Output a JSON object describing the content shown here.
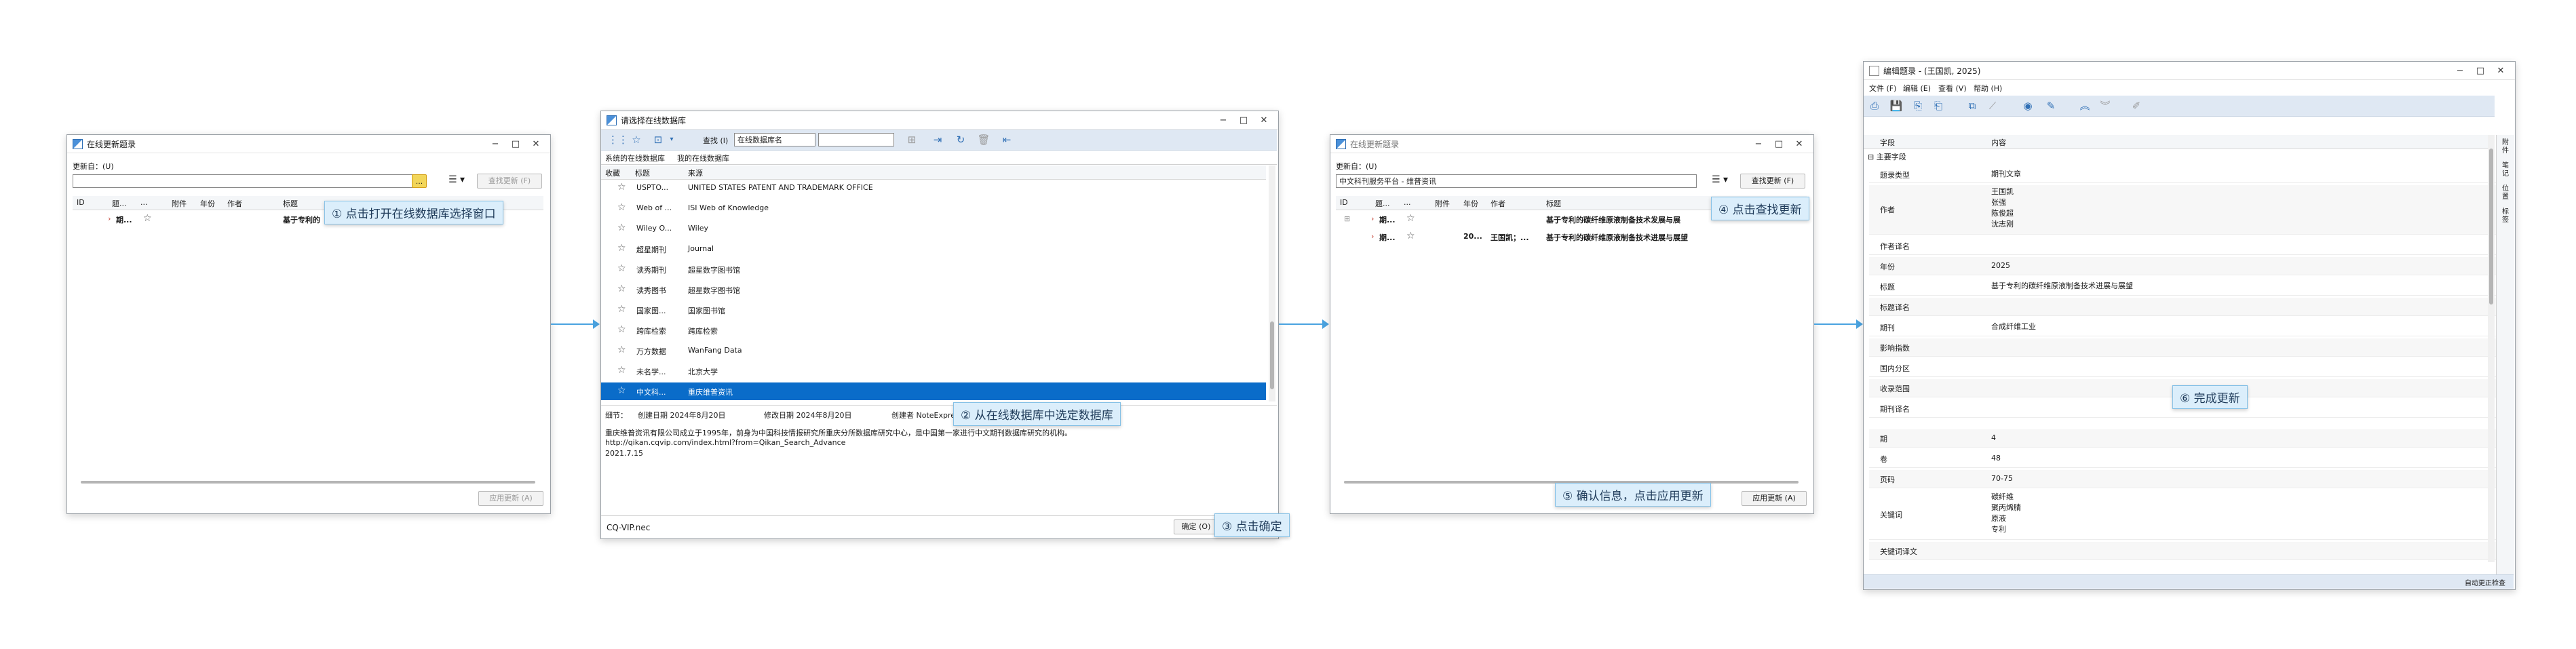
{
  "colors": {
    "accent": "#0a6cc9",
    "callout_bg": "#dbeefb",
    "arrow": "#4aa3e0"
  },
  "w1": {
    "title": "在线更新题录",
    "update_from_label": "更新自：(U)",
    "update_from_value": "",
    "browse_btn": "...",
    "menu_icon": "list-icon",
    "find_btn": "查找更新 (F)",
    "cols": [
      "ID",
      "题...",
      "...",
      "附件",
      "年份",
      "作者",
      "标题"
    ],
    "row": {
      "title_short": "期...",
      "title": "基于专利的"
    },
    "apply_btn": "应用更新 (A)"
  },
  "w2": {
    "title": "请选择在线数据库",
    "search_label": "查找 (I)",
    "search_field": "在线数据库名",
    "tabs": [
      "系统的在线数据库",
      "我的在线数据库"
    ],
    "cols": [
      "收藏",
      "标题",
      "来源"
    ],
    "rows": [
      {
        "name": "USPTO...",
        "source": "UNITED STATES PATENT AND TRADEMARK OFFICE"
      },
      {
        "name": "Web of ...",
        "source": "ISI Web of Knowledge"
      },
      {
        "name": "Wiley O...",
        "source": "Wiley"
      },
      {
        "name": "超星期刊",
        "source": "Journal"
      },
      {
        "name": "读秀期刊",
        "source": "超星数字图书馆"
      },
      {
        "name": "读秀图书",
        "source": "超星数字图书馆"
      },
      {
        "name": "国家图...",
        "source": "国家图书馆"
      },
      {
        "name": "跨库检索",
        "source": "跨库检索"
      },
      {
        "name": "万方数据",
        "source": "WanFang Data"
      },
      {
        "name": "未名学...",
        "source": "北京大学"
      },
      {
        "name": "中文科...",
        "source": "重庆维普资讯"
      }
    ],
    "detail": {
      "label": "细节：",
      "created": "创建日期  2024年8月20日",
      "modified": "修改日期  2024年8月20日",
      "creator": "创建者  NoteExpress",
      "desc": "重庆维普资讯有限公司成立于1995年，前身为中国科技情报研究所重庆分所数据库研究中心，是中国第一家进行中文期刊数据库研究的机构。",
      "url": "http://qikan.cqvip.com/index.html?from=Qikan_Search_Advance",
      "date": "2021.7.15"
    },
    "status": "CQ-VIP.nec",
    "ok_btn": "确定 (O)"
  },
  "w3": {
    "title": "在线更新题录",
    "update_from_label": "更新自：(U)",
    "update_from_value": "中文科刊服务平台 - 维普资讯",
    "find_btn": "查找更新 (F)",
    "cols": [
      "ID",
      "题...",
      "...",
      "附件",
      "年份",
      "作者",
      "标题"
    ],
    "row1": {
      "type": "期...",
      "title": "基于专利的碳纤维原液制备技术发展与展"
    },
    "row2": {
      "type": "期...",
      "year": "20...",
      "author": "王国凯；...",
      "title": "基于专利的碳纤维原液制备技术进展与展望"
    },
    "apply_btn": "应用更新 (A)"
  },
  "w4": {
    "title": "编辑题录 - (王国凯, 2025)",
    "menu": [
      "文件 (F)",
      "编辑 (E)",
      "查看 (V)",
      "帮助 (H)"
    ],
    "cols": [
      "字段",
      "内容"
    ],
    "group": "主要字段",
    "fields": [
      {
        "k": "题录类型",
        "v": "期刊文章"
      },
      {
        "k": "作者",
        "v": "王国凯\n张强\n陈俊超\n沈志刚"
      },
      {
        "k": "作者译名",
        "v": ""
      },
      {
        "k": "年份",
        "v": "2025"
      },
      {
        "k": "标题",
        "v": "基于专利的碳纤维原液制备技术进展与展望"
      },
      {
        "k": "标题译名",
        "v": ""
      },
      {
        "k": "期刊",
        "v": "合成纤维工业"
      },
      {
        "k": "影响指数",
        "v": ""
      },
      {
        "k": "国内分区",
        "v": ""
      },
      {
        "k": "收录范围",
        "v": ""
      },
      {
        "k": "期刊译名",
        "v": ""
      },
      {
        "k": "期",
        "v": "4"
      },
      {
        "k": "卷",
        "v": "48"
      },
      {
        "k": "页码",
        "v": "70-75"
      },
      {
        "k": "关键词",
        "v": "碳纤维\n聚丙烯腈\n原液\n专利"
      },
      {
        "k": "关键词译文",
        "v": ""
      }
    ],
    "side_tabs": [
      "附件",
      "笔记",
      "位置",
      "标签"
    ],
    "status": "自动更正检查"
  },
  "callouts": {
    "c1": "① 点击打开在线数据库选择窗口",
    "c2": "② 从在线数据库中选定数据库",
    "c3": "③ 点击确定",
    "c4": "④ 点击查找更新",
    "c5": "⑤ 确认信息，点击应用更新",
    "c6": "⑥ 完成更新"
  }
}
